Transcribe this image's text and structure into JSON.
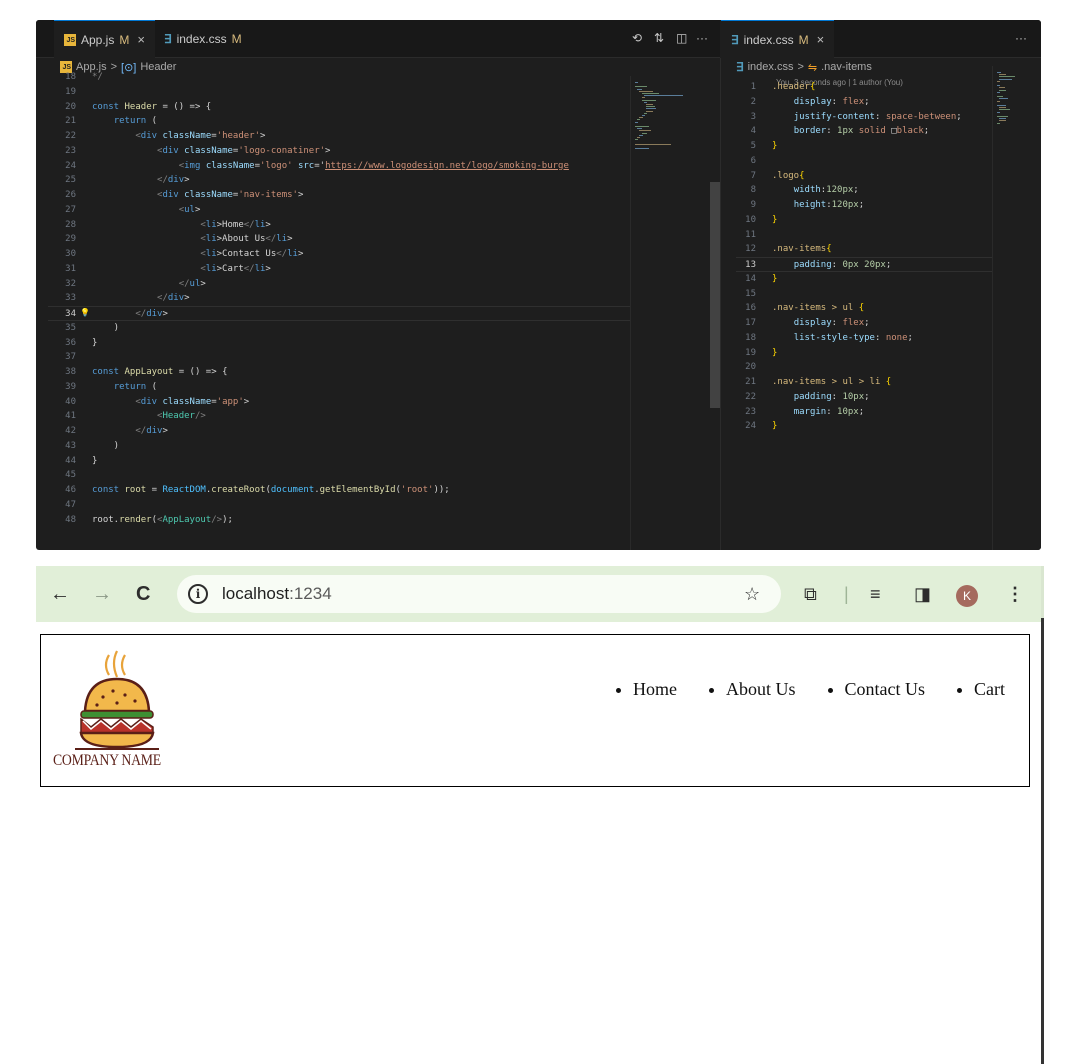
{
  "vscode": {
    "left_tabs": [
      {
        "label": "App.js",
        "modifier": "M",
        "close": "×"
      },
      {
        "label": "index.css",
        "modifier": "M"
      }
    ],
    "right_tab": {
      "label": "index.css",
      "modifier": "M",
      "close": "×"
    },
    "more_icon": "···",
    "left_breadcrumb": {
      "file": "App.js",
      "sep": ">",
      "symbol": "Header"
    },
    "right_breadcrumb": {
      "file": "index.css",
      "sep": ">",
      "symbol": ".nav-items"
    },
    "blame": "You, 3 seconds ago | 1 author (You)",
    "js_lines": [
      {
        "n": "18",
        "code": "*/"
      },
      {
        "n": "19",
        "code": ""
      },
      {
        "n": "20",
        "code": "const Header = () => {"
      },
      {
        "n": "21",
        "code": "    return ("
      },
      {
        "n": "22",
        "code": "        <div className='header'>"
      },
      {
        "n": "23",
        "code": "            <div className='logo-conatiner'>"
      },
      {
        "n": "24",
        "code": "                <img className='logo' src='https://www.logodesign.net/logo/smoking-burge"
      },
      {
        "n": "25",
        "code": "            </div>"
      },
      {
        "n": "26",
        "code": "            <div className='nav-items'>"
      },
      {
        "n": "27",
        "code": "                <ul>"
      },
      {
        "n": "28",
        "code": "                    <li>Home</li>"
      },
      {
        "n": "29",
        "code": "                    <li>About Us</li>"
      },
      {
        "n": "30",
        "code": "                    <li>Contact Us</li>"
      },
      {
        "n": "31",
        "code": "                    <li>Cart</li>"
      },
      {
        "n": "32",
        "code": "                </ul>"
      },
      {
        "n": "33",
        "code": "            </div>"
      },
      {
        "n": "34",
        "code": "        </div>"
      },
      {
        "n": "35",
        "code": "    )"
      },
      {
        "n": "36",
        "code": "}"
      },
      {
        "n": "37",
        "code": ""
      },
      {
        "n": "38",
        "code": "const AppLayout = () => {"
      },
      {
        "n": "39",
        "code": "    return ("
      },
      {
        "n": "40",
        "code": "        <div className='app'>"
      },
      {
        "n": "41",
        "code": "            <Header/>"
      },
      {
        "n": "42",
        "code": "        </div>"
      },
      {
        "n": "43",
        "code": "    )"
      },
      {
        "n": "44",
        "code": "}"
      },
      {
        "n": "45",
        "code": ""
      },
      {
        "n": "46",
        "code": "const root = ReactDOM.createRoot(document.getElementById('root'));"
      },
      {
        "n": "47",
        "code": ""
      },
      {
        "n": "48",
        "code": "root.render(<AppLayout/>);"
      }
    ],
    "css_lines": [
      {
        "n": "1",
        "code": ".header{"
      },
      {
        "n": "2",
        "code": "    display: flex;"
      },
      {
        "n": "3",
        "code": "    justify-content: space-between;"
      },
      {
        "n": "4",
        "code": "    border: 1px solid □black;"
      },
      {
        "n": "5",
        "code": "}"
      },
      {
        "n": "6",
        "code": ""
      },
      {
        "n": "7",
        "code": ".logo{"
      },
      {
        "n": "8",
        "code": "    width:120px;"
      },
      {
        "n": "9",
        "code": "    height:120px;"
      },
      {
        "n": "10",
        "code": "}"
      },
      {
        "n": "11",
        "code": ""
      },
      {
        "n": "12",
        "code": ".nav-items{"
      },
      {
        "n": "13",
        "code": "    padding: 0px 20px;"
      },
      {
        "n": "14",
        "code": "}"
      },
      {
        "n": "15",
        "code": ""
      },
      {
        "n": "16",
        "code": ".nav-items > ul {"
      },
      {
        "n": "17",
        "code": "    display: flex;"
      },
      {
        "n": "18",
        "code": "    list-style-type: none;"
      },
      {
        "n": "19",
        "code": "}"
      },
      {
        "n": "20",
        "code": ""
      },
      {
        "n": "21",
        "code": ".nav-items > ul > li {"
      },
      {
        "n": "22",
        "code": "    padding: 10px;"
      },
      {
        "n": "23",
        "code": "    margin: 10px;"
      },
      {
        "n": "24",
        "code": "}"
      }
    ]
  },
  "browser": {
    "url_host": "localhost",
    "url_port": ":1234",
    "avatar_letter": "K",
    "page": {
      "company_name": "COMPANY NAME",
      "nav_items": [
        "Home",
        "About Us",
        "Contact Us",
        "Cart"
      ]
    }
  },
  "colors": {
    "chrome_bar": "#e1efd8",
    "editor_bg": "#1e1e1e",
    "brand_burger": "#e8a33a"
  }
}
